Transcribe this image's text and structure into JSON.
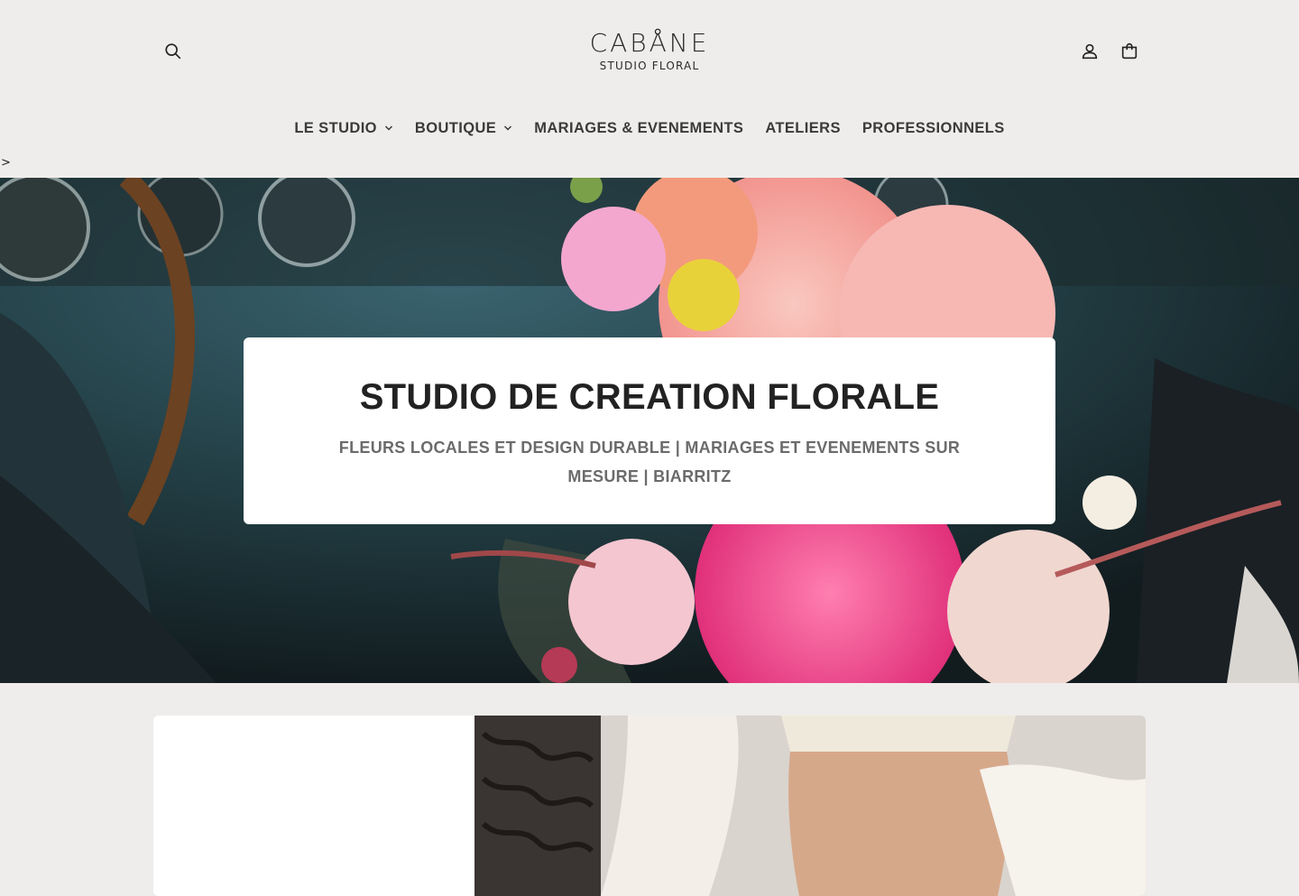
{
  "header": {
    "logo_main": "CABÅNE",
    "logo_sub": "STUDIO FLORAL",
    "icons": [
      "search-icon",
      "account-icon",
      "cart-icon"
    ]
  },
  "nav": {
    "items": [
      {
        "label": "LE STUDIO",
        "has_dropdown": true
      },
      {
        "label": "BOUTIQUE",
        "has_dropdown": true
      },
      {
        "label": "MARIAGES & EVENEMENTS",
        "has_dropdown": false
      },
      {
        "label": "ATELIERS",
        "has_dropdown": false
      },
      {
        "label": "PROFESSIONNELS",
        "has_dropdown": false
      }
    ]
  },
  "stray_text": ">",
  "hero": {
    "title": "STUDIO DE CREATION FLORALE",
    "subtitle": "FLEURS LOCALES ET DESIGN DURABLE | MARIAGES ET EVENEMENTS SUR MESURE | BIARRITZ"
  },
  "colors": {
    "page_bg": "#efedeb",
    "card_bg": "#ffffff",
    "text_dark": "#222222",
    "text_muted": "#6b6b6b"
  }
}
